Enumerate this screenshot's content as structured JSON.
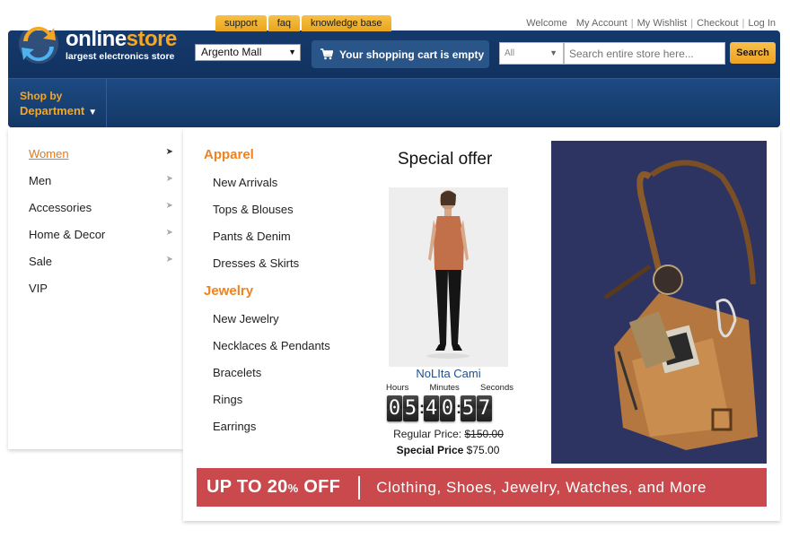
{
  "header": {
    "tabs": [
      "support",
      "faq",
      "knowledge base"
    ],
    "top_links": [
      "Welcome",
      "My Account",
      "My Wishlist",
      "Checkout",
      "Log In"
    ],
    "logo_name_part1": "online",
    "logo_name_part2": "store",
    "logo_tagline": "largest electronics store",
    "mall_select": "Argento Mall",
    "cart_text": "Your shopping cart is empty",
    "search": {
      "category": "All",
      "placeholder": "Search entire store here...",
      "button": "Search"
    },
    "shop_by_line1": "Shop by",
    "shop_by_line2": "Department"
  },
  "menu": {
    "categories": [
      {
        "label": "Women",
        "active": true,
        "has_submenu": true
      },
      {
        "label": "Men",
        "has_submenu": true
      },
      {
        "label": "Accessories",
        "has_submenu": true
      },
      {
        "label": "Home & Decor",
        "has_submenu": true
      },
      {
        "label": "Sale",
        "has_submenu": true
      },
      {
        "label": "VIP",
        "has_submenu": false
      }
    ],
    "sections": [
      {
        "title": "Apparel",
        "items": [
          "New Arrivals",
          "Tops & Blouses",
          "Pants & Denim",
          "Dresses & Skirts"
        ]
      },
      {
        "title": "Jewelry",
        "items": [
          "New Jewelry",
          "Necklaces & Pendants",
          "Bracelets",
          "Rings",
          "Earrings"
        ]
      }
    ]
  },
  "offer": {
    "title": "Special offer",
    "product_name": "NoLIta Cami",
    "timer_labels": [
      "Hours",
      "Minutes",
      "Seconds"
    ],
    "timer": {
      "hours": "05",
      "minutes": "40",
      "seconds": "57"
    },
    "regular_label": "Regular Price:",
    "regular_price": "$150.00",
    "special_label": "Special Price",
    "special_price": "$75.00"
  },
  "banner": {
    "main": "UP TO 20",
    "pct": "%",
    "off": " OFF",
    "text": "Clothing, Shoes, Jewelry, Watches, and More"
  },
  "colors": {
    "header_blue": "#15396b",
    "accent_orange": "#f0821f",
    "banner_red": "#c9494c",
    "tab_yellow": "#f7c046"
  }
}
